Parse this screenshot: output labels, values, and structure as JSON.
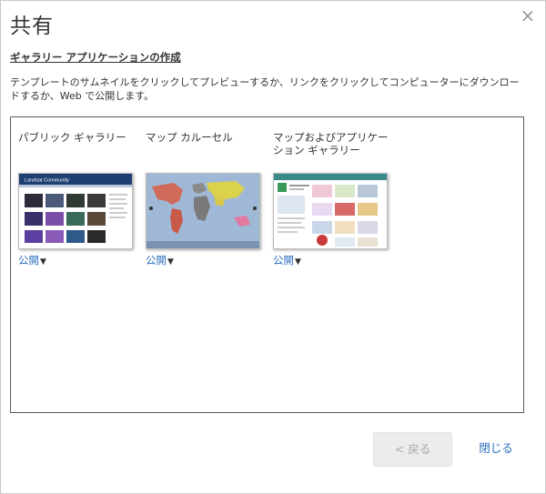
{
  "dialog": {
    "title": "共有",
    "close_glyph": "×"
  },
  "heading": "ギャラリー アプリケーションの作成",
  "instructions": "テンプレートのサムネイルをクリックしてプレビューするか、リンクをクリックしてコンピューターにダウンロードするか、Web で公開します。",
  "templates": [
    {
      "name": "パブリック ギャラリー",
      "thumb_header": "Landsat Community",
      "publish_label": "公開",
      "publish_arrow": "▼"
    },
    {
      "name": "マップ カルーセル",
      "publish_label": "公開",
      "publish_arrow": "▼"
    },
    {
      "name": "マップおよびアプリケーション ギャラリー",
      "publish_label": "公開",
      "publish_arrow": "▼"
    }
  ],
  "buttons": {
    "back": "< 戻る",
    "close": "閉じる"
  },
  "colors": {
    "link": "#2a6ebd",
    "border": "#5a5a5a",
    "disabled_bg": "#ececec"
  }
}
